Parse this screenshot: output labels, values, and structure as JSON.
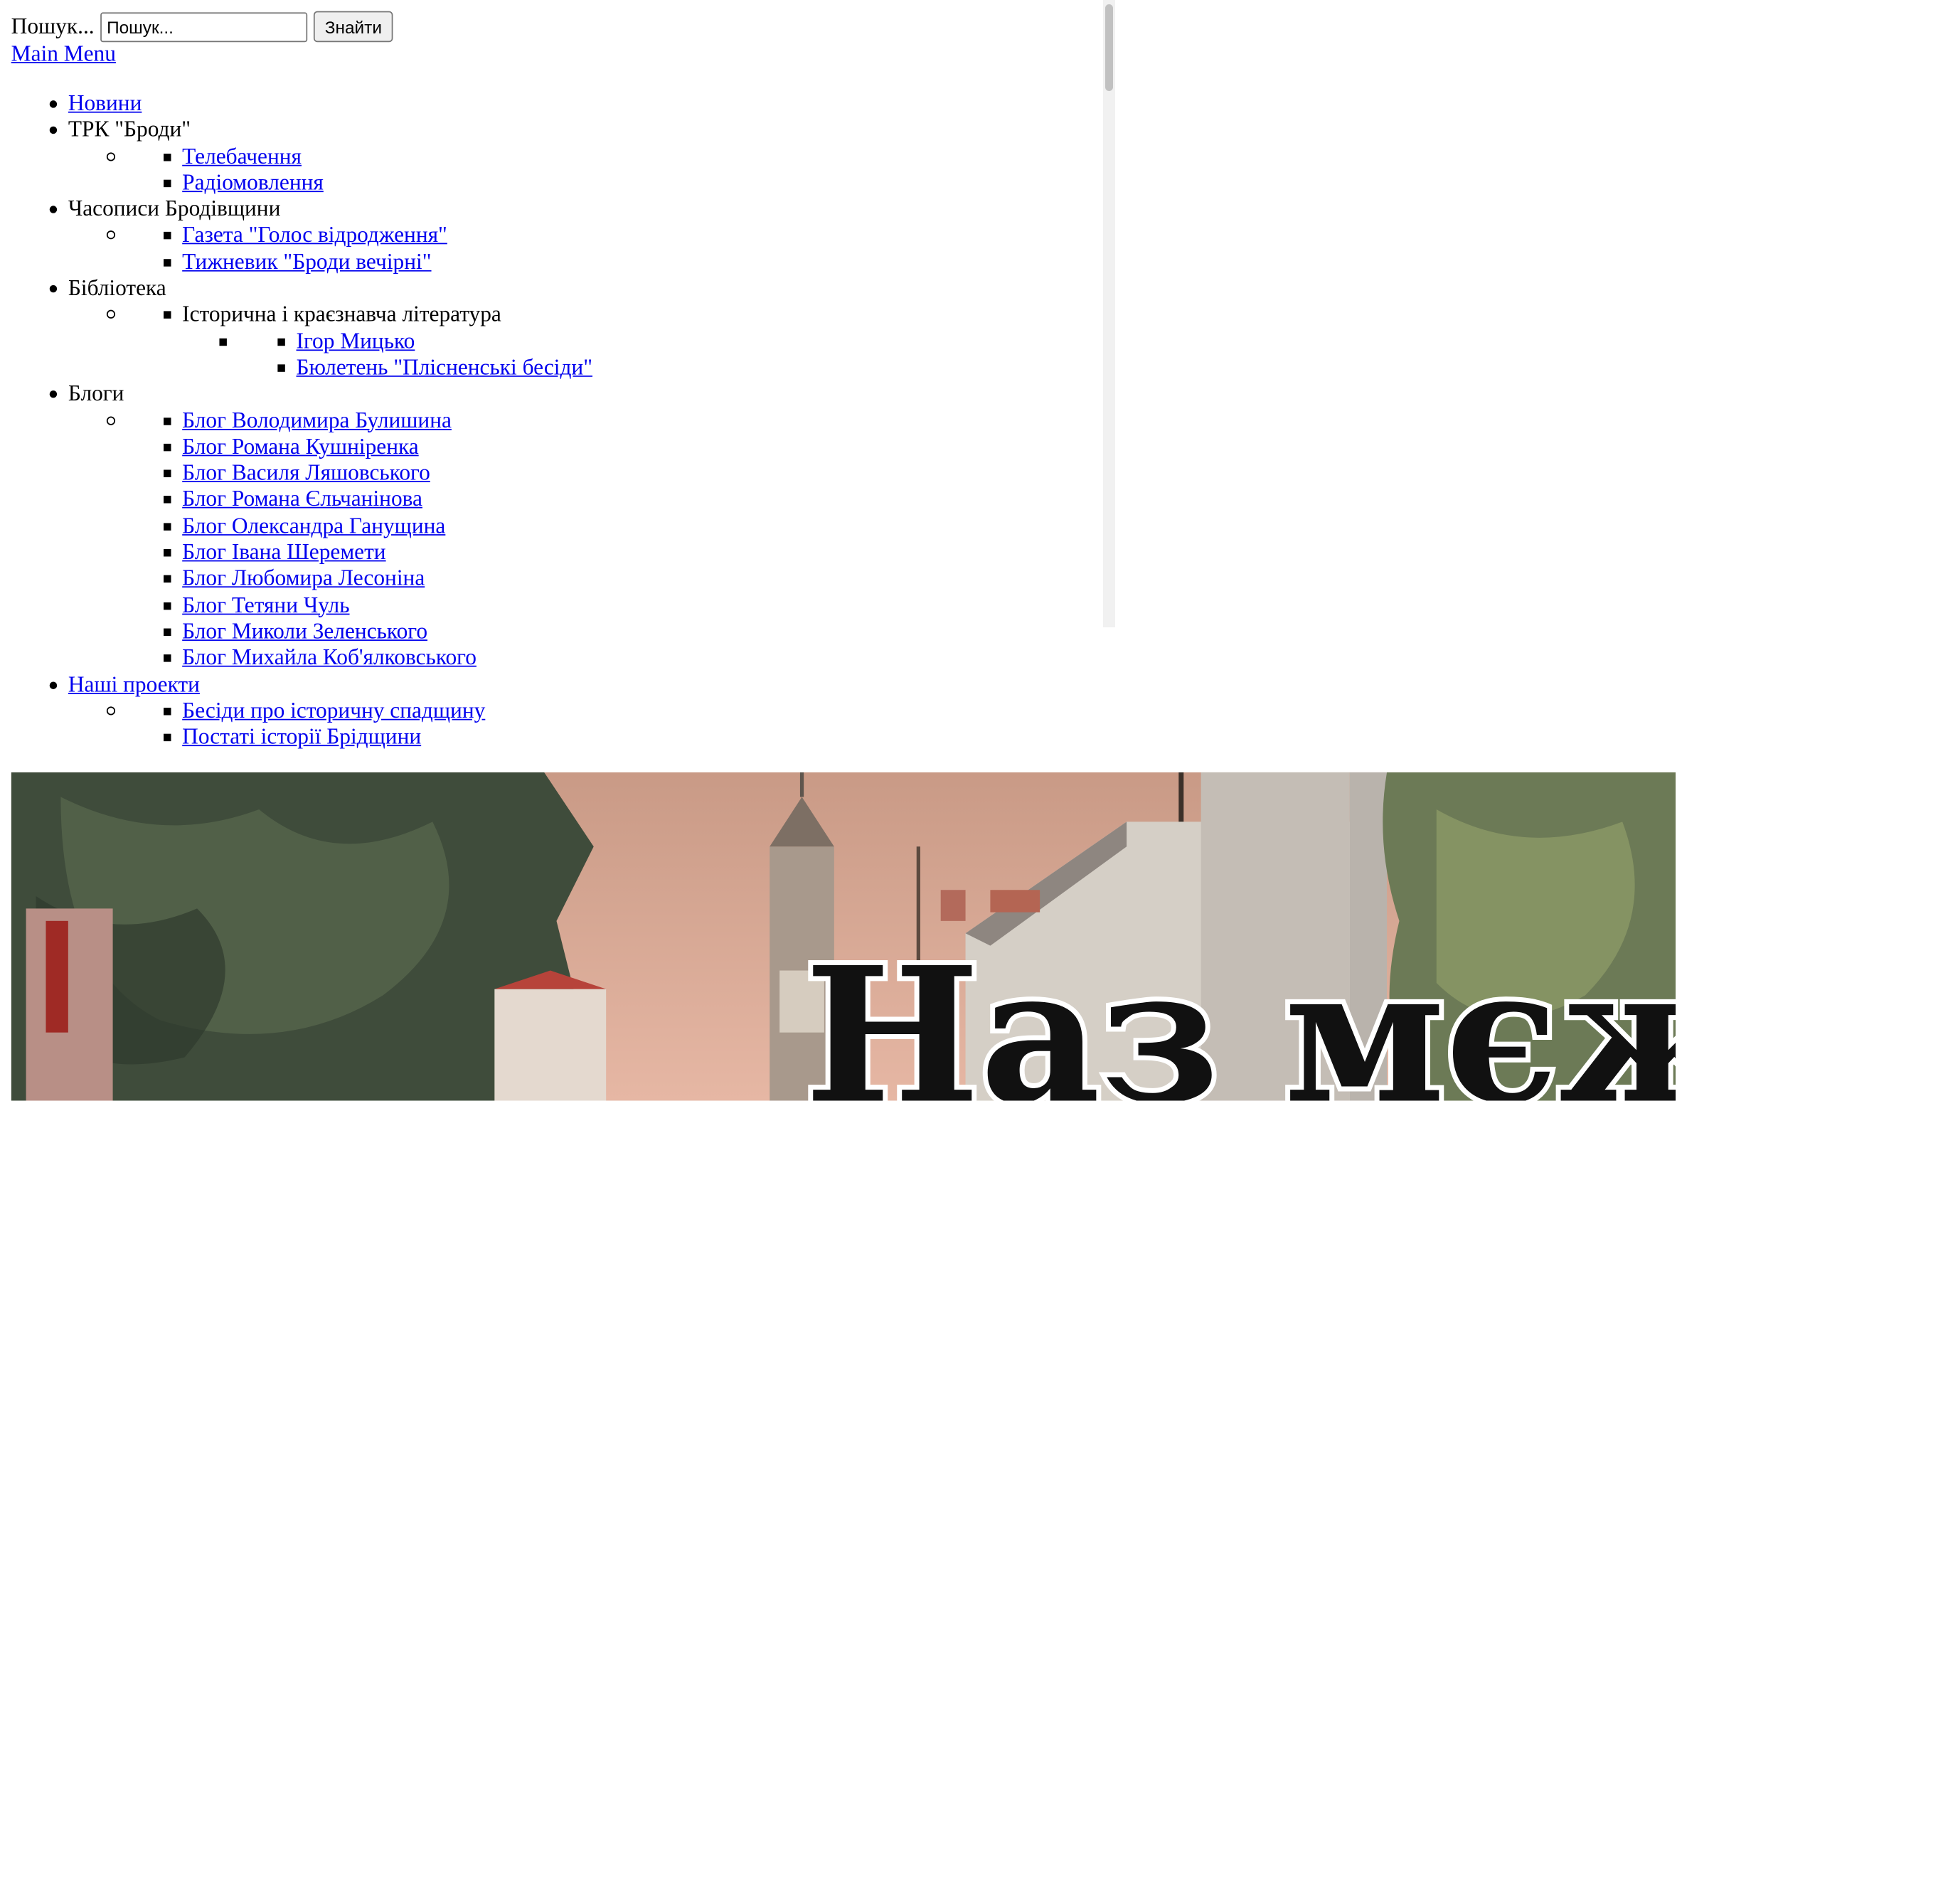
{
  "search": {
    "label": "Пошук...",
    "placeholder": "Пошук...",
    "button_label": "Знайти"
  },
  "main_menu_link": "Main Menu",
  "menu": {
    "news": "Новини",
    "trk": {
      "label": "ТРК \"Броди\"",
      "items": [
        "Телебачення",
        "Радіомовлення"
      ]
    },
    "periodicals": {
      "label": "Часописи Бродівщини",
      "items": [
        "Газета \"Голос відродження\"",
        "Тижневик \"Броди вечірні\""
      ]
    },
    "library": {
      "label": "Бібліотека",
      "subheading": "Історична і краєзнавча література",
      "items": [
        "Ігор Мицько",
        "Бюлетень \"Плісненські бесіди\""
      ]
    },
    "blogs": {
      "label": "Блоги",
      "items": [
        "Блог Володимира Булишина",
        "Блог Романа Кушніренка",
        "Блог Василя Ляшовського",
        "Блог Романа Єльчанінова",
        "Блог Олександра Ганущина",
        "Блог Івана Шеремети",
        "Блог Любомира Лесоніна",
        "Блог Тетяни Чуль",
        "Блог Миколи Зеленського",
        "Блог Михайла Коб'ялковського"
      ]
    },
    "projects": {
      "label": "Наші проекти",
      "items": [
        "Бесіди про історичну спадщину",
        "Постаті історії Брідщини"
      ]
    }
  },
  "header_image": {
    "logo_text": "Наз мєжі"
  },
  "colors": {
    "link": "#0000ee",
    "text": "#000000",
    "background": "#ffffff"
  }
}
